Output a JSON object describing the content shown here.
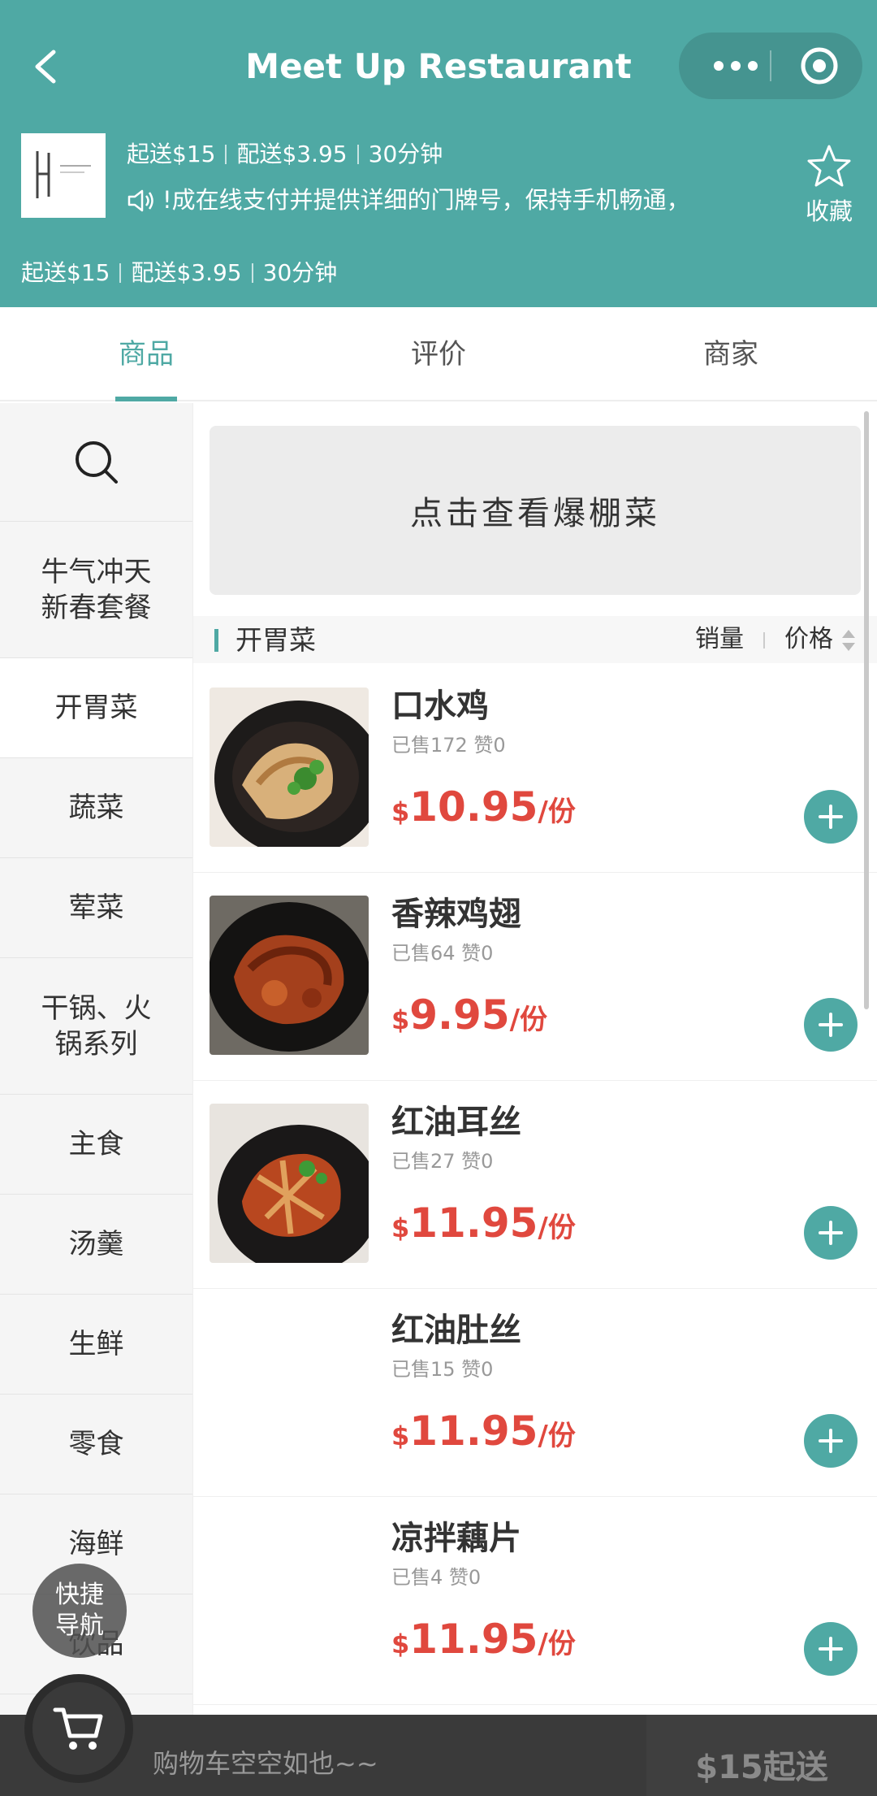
{
  "header": {
    "title": "Meet Up Restaurant",
    "info": {
      "min_order": "起送$15",
      "delivery_fee": "配送$3.95",
      "time": "30分钟"
    },
    "notice": "!成在线支付并提供详细的门牌号，保持手机畅通，",
    "favorite_label": "收藏"
  },
  "tabs": [
    {
      "label": "商品",
      "active": true
    },
    {
      "label": "评价",
      "active": false
    },
    {
      "label": "商家",
      "active": false
    }
  ],
  "sidebar": {
    "items": [
      {
        "label": "牛气冲天新春套餐"
      },
      {
        "label": "开胃菜"
      },
      {
        "label": "蔬菜"
      },
      {
        "label": "荤菜"
      },
      {
        "label": "干锅、火锅系列"
      },
      {
        "label": "主食"
      },
      {
        "label": "汤羹"
      },
      {
        "label": "生鲜"
      },
      {
        "label": "零食"
      },
      {
        "label": "海鲜"
      },
      {
        "label": "饮品"
      }
    ]
  },
  "banner": {
    "text": "点击查看爆棚菜"
  },
  "section": {
    "name": "开胃菜",
    "sort_sales": "销量",
    "sort_price": "价格"
  },
  "products": [
    {
      "name": "口水鸡",
      "sales": "已售172 赞0",
      "currency": "$",
      "price": "10.95",
      "unit": "/份"
    },
    {
      "name": "香辣鸡翅",
      "sales": "已售64 赞0",
      "currency": "$",
      "price": "9.95",
      "unit": "/份"
    },
    {
      "name": "红油耳丝",
      "sales": "已售27 赞0",
      "currency": "$",
      "price": "11.95",
      "unit": "/份"
    },
    {
      "name": "红油肚丝",
      "sales": "已售15 赞0",
      "currency": "$",
      "price": "11.95",
      "unit": "/份"
    },
    {
      "name": "凉拌藕片",
      "sales": "已售4 赞0",
      "currency": "$",
      "price": "11.95",
      "unit": "/份"
    }
  ],
  "quick_nav": {
    "line1": "快捷",
    "line2": "导航"
  },
  "cart": {
    "empty_text": "购物车空空如也~~",
    "min_order_label": "$15起送"
  },
  "colors": {
    "primary": "#4fa9a4",
    "price": "#e0483e",
    "cart_bar": "#3a3a3a"
  },
  "icons": [
    "back-arrow-icon",
    "more-dots-icon",
    "target-icon",
    "speaker-icon",
    "star-icon",
    "search-icon",
    "sort-arrows-icon",
    "plus-icon",
    "cart-icon"
  ]
}
